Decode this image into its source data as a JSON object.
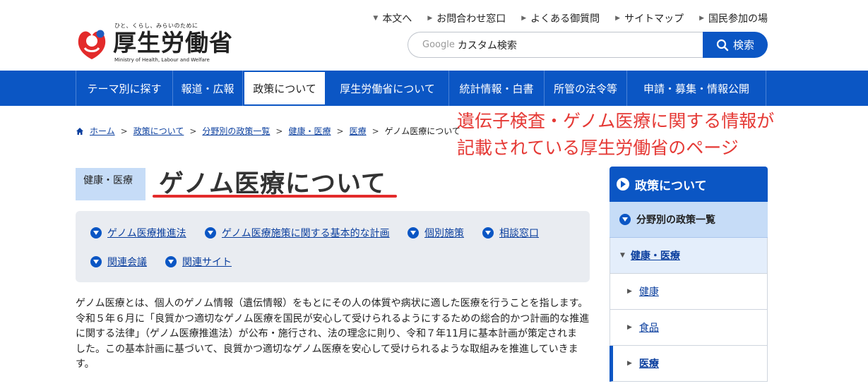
{
  "header": {
    "logo_tagline": "ひと、くらし、みらいのために",
    "logo_title": "厚生労働省",
    "logo_en": "Ministry of Health, Labour and Welfare",
    "util_nav": [
      "本文へ",
      "お問合わせ窓口",
      "よくある御質問",
      "サイトマップ",
      "国民参加の場"
    ],
    "search": {
      "google_label": "Google",
      "placeholder": "カスタム検索",
      "button_label": "検索"
    }
  },
  "gnav": [
    "テーマ別に探す",
    "報道・広報",
    "政策について",
    "厚生労働省について",
    "統計情報・白書",
    "所管の法令等",
    "申請・募集・情報公開"
  ],
  "breadcrumb": [
    "ホーム",
    "政策について",
    "分野別の政策一覧",
    "健康・医療",
    "医療",
    "ゲノム医療について"
  ],
  "annotation": [
    "遺伝子検査・ゲノム医療に関する情報が",
    "記載されている厚生労働省のページ"
  ],
  "category_badge": "健康・医療",
  "page_title": "ゲノム医療について",
  "anchor_links": [
    "ゲノム医療推進法",
    "ゲノム医療施策に関する基本的な計画",
    "個別施策",
    "相談窓口",
    "関連会議",
    "関連サイト"
  ],
  "intro": [
    "ゲノム医療とは、個人のゲノム情報（遺伝情報）をもとにその人の体質や病状に適した医療を行うことを指します。",
    "令和５年６月に「良質かつ適切なゲノム医療を国民が安心して受けられるようにするための総合的かつ計画的な推進",
    "に関する法律」（ゲノム医療推進法）が公布・施行され、法の理念に則り、令和７年11月に基本計画が策定されま",
    "した。この基本計画に基づいて、良質かつ適切なゲノム医療を安心して受けられるような取組みを推進していきま",
    "す。"
  ],
  "side_nav": {
    "title": "政策について",
    "sub": "分野別の政策一覧",
    "items": [
      "健康・医療",
      "健康",
      "食品",
      "医療"
    ]
  },
  "colors": {
    "brand_blue": "#0b56c4",
    "light_blue": "#c6dcf7",
    "annotation_red": "#e53935"
  }
}
